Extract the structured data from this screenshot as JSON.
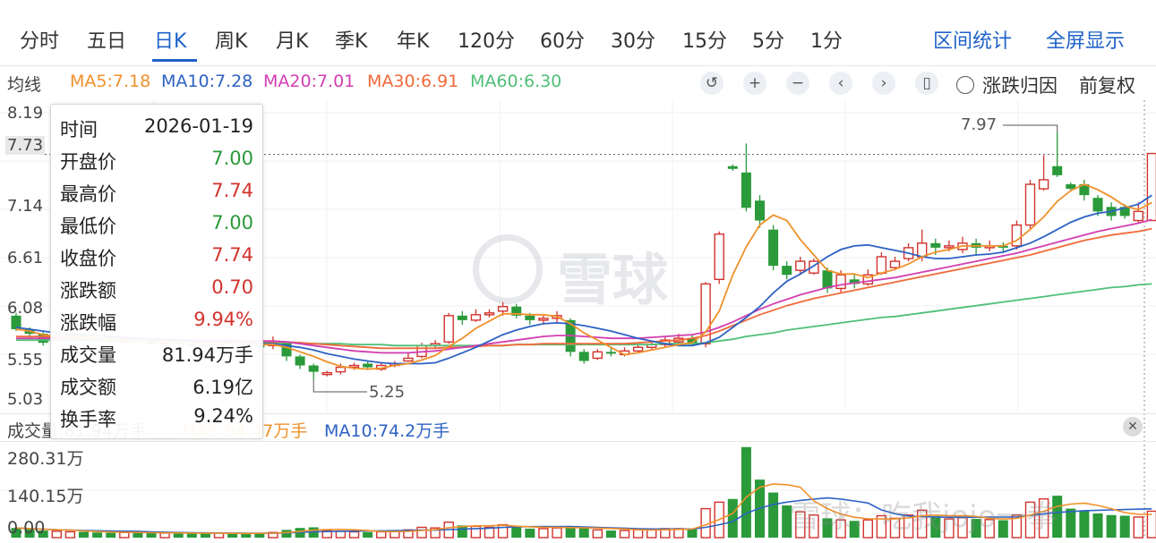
{
  "tabs": [
    {
      "label": "分时"
    },
    {
      "label": "五日"
    },
    {
      "label": "日K"
    },
    {
      "label": "周K"
    },
    {
      "label": "月K"
    },
    {
      "label": "季K"
    },
    {
      "label": "年K"
    },
    {
      "label": "120分"
    },
    {
      "label": "60分"
    },
    {
      "label": "30分"
    },
    {
      "label": "15分"
    },
    {
      "label": "5分"
    },
    {
      "label": "1分"
    }
  ],
  "active_tab": "日K",
  "right_links": {
    "interval_stats": "区间统计",
    "fullscreen": "全屏显示"
  },
  "ma_bar": {
    "label": "均线",
    "items": [
      {
        "text": "MA5:7.18",
        "color": "#f0912a"
      },
      {
        "text": "MA10:7.28",
        "color": "#2d62c4"
      },
      {
        "text": "MA20:7.01",
        "color": "#d23fb1"
      },
      {
        "text": "MA30:6.91",
        "color": "#f06a3a"
      },
      {
        "text": "MA60:6.30",
        "color": "#4fbf77"
      }
    ]
  },
  "toolbar_icons": [
    "undo-icon",
    "plus-icon",
    "minus-icon",
    "chevron-left-icon",
    "chevron-right-icon",
    "candle-icon"
  ],
  "reason_label": "涨跌归因",
  "adjust_label": "前复权",
  "y_axis": [
    "8.19",
    "7.73",
    "7.14",
    "6.61",
    "6.08",
    "5.55",
    "5.03"
  ],
  "annotations": {
    "high": "7.97",
    "low": "5.25"
  },
  "watermark": "雪球",
  "tooltip": [
    {
      "k": "时间",
      "v": "2026-01-19",
      "c": "#222"
    },
    {
      "k": "开盘价",
      "v": "7.00",
      "c": "#2a9a3a"
    },
    {
      "k": "最高价",
      "v": "7.74",
      "c": "#d2322d"
    },
    {
      "k": "最低价",
      "v": "7.00",
      "c": "#2a9a3a"
    },
    {
      "k": "收盘价",
      "v": "7.74",
      "c": "#d2322d"
    },
    {
      "k": "涨跌额",
      "v": "0.70",
      "c": "#d2322d"
    },
    {
      "k": "涨跌幅",
      "v": "9.94%",
      "c": "#d2322d"
    },
    {
      "k": "成交量",
      "v": "81.94万手",
      "c": "#222"
    },
    {
      "k": "成交额",
      "v": "6.19亿",
      "c": "#222"
    },
    {
      "k": "换手率",
      "v": "9.24%",
      "c": "#222"
    }
  ],
  "volume_header": {
    "vol": "成交量:81.94万手",
    "ma5": "MA5:64.47万手",
    "ma10": "MA10:74.2万手"
  },
  "volume_axis": [
    "280.31万",
    "140.15万",
    "0.00"
  ],
  "bottom_watermark": "雪球：吃我jojo一拳",
  "chart_data": {
    "type": "candlestick",
    "price_range": [
      5.03,
      8.19
    ],
    "volume_max": 280.31,
    "candles": [
      [
        5.95,
        5.8,
        5.98,
        5.78
      ],
      [
        5.8,
        5.75,
        5.82,
        5.7
      ],
      [
        5.75,
        5.65,
        5.78,
        5.62
      ],
      [
        5.7,
        5.72,
        5.76,
        5.66
      ],
      [
        5.72,
        5.74,
        5.78,
        5.7
      ],
      [
        5.74,
        5.7,
        5.76,
        5.68
      ],
      [
        5.7,
        5.68,
        5.73,
        5.66
      ],
      [
        5.68,
        5.66,
        5.7,
        5.64
      ],
      [
        5.66,
        5.68,
        5.72,
        5.63
      ],
      [
        5.68,
        5.66,
        5.7,
        5.64
      ],
      [
        5.66,
        5.65,
        5.68,
        5.62
      ],
      [
        5.65,
        5.66,
        5.69,
        5.63
      ],
      [
        5.66,
        5.64,
        5.68,
        5.62
      ],
      [
        5.64,
        5.63,
        5.66,
        5.6
      ],
      [
        5.63,
        5.62,
        5.66,
        5.6
      ],
      [
        5.62,
        5.66,
        5.7,
        5.6
      ],
      [
        5.66,
        5.64,
        5.68,
        5.62
      ],
      [
        5.64,
        5.62,
        5.66,
        5.6
      ],
      [
        5.62,
        5.6,
        5.64,
        5.56
      ],
      [
        5.62,
        5.64,
        5.72,
        5.58
      ],
      [
        5.65,
        5.5,
        5.66,
        5.45
      ],
      [
        5.5,
        5.4,
        5.52,
        5.36
      ],
      [
        5.4,
        5.33,
        5.42,
        5.25
      ],
      [
        5.3,
        5.32,
        5.34,
        5.28
      ],
      [
        5.33,
        5.38,
        5.42,
        5.3
      ],
      [
        5.38,
        5.4,
        5.43,
        5.35
      ],
      [
        5.42,
        5.38,
        5.44,
        5.35
      ],
      [
        5.36,
        5.4,
        5.43,
        5.34
      ],
      [
        5.4,
        5.42,
        5.45,
        5.38
      ],
      [
        5.45,
        5.48,
        5.55,
        5.44
      ],
      [
        5.5,
        5.62,
        5.65,
        5.48
      ],
      [
        5.62,
        5.64,
        5.68,
        5.58
      ],
      [
        5.66,
        5.95,
        5.98,
        5.64
      ],
      [
        5.95,
        5.9,
        6.0,
        5.85
      ],
      [
        5.9,
        5.96,
        6.02,
        5.88
      ],
      [
        5.96,
        5.98,
        6.02,
        5.93
      ],
      [
        6.0,
        6.05,
        6.1,
        5.95
      ],
      [
        6.05,
        5.95,
        6.08,
        5.92
      ],
      [
        5.95,
        5.9,
        5.98,
        5.85
      ],
      [
        5.9,
        5.92,
        5.95,
        5.86
      ],
      [
        5.92,
        5.95,
        6.0,
        5.88
      ],
      [
        5.9,
        5.55,
        5.92,
        5.5
      ],
      [
        5.55,
        5.45,
        5.58,
        5.42
      ],
      [
        5.48,
        5.55,
        5.58,
        5.46
      ],
      [
        5.55,
        5.53,
        5.6,
        5.5
      ],
      [
        5.52,
        5.56,
        5.6,
        5.5
      ],
      [
        5.56,
        5.6,
        5.64,
        5.54
      ],
      [
        5.6,
        5.63,
        5.66,
        5.58
      ],
      [
        5.63,
        5.68,
        5.72,
        5.6
      ],
      [
        5.66,
        5.7,
        5.75,
        5.64
      ],
      [
        5.7,
        5.65,
        5.74,
        5.62
      ],
      [
        5.64,
        6.3,
        6.32,
        5.6
      ],
      [
        6.35,
        6.85,
        6.88,
        6.3
      ],
      [
        7.6,
        7.57,
        7.62,
        7.55
      ],
      [
        7.53,
        7.14,
        7.85,
        7.1
      ],
      [
        7.22,
        7.0,
        7.28,
        6.92
      ],
      [
        6.9,
        6.5,
        6.95,
        6.45
      ],
      [
        6.5,
        6.4,
        6.55,
        6.35
      ],
      [
        6.45,
        6.55,
        6.6,
        6.4
      ],
      [
        6.42,
        6.55,
        6.58,
        6.4
      ],
      [
        6.45,
        6.25,
        6.48,
        6.2
      ],
      [
        6.25,
        6.4,
        6.45,
        6.2
      ],
      [
        6.35,
        6.3,
        6.42,
        6.25
      ],
      [
        6.3,
        6.4,
        6.46,
        6.28
      ],
      [
        6.42,
        6.6,
        6.65,
        6.4
      ],
      [
        6.48,
        6.55,
        6.6,
        6.45
      ],
      [
        6.58,
        6.7,
        6.75,
        6.55
      ],
      [
        6.6,
        6.75,
        6.9,
        6.55
      ],
      [
        6.75,
        6.7,
        6.8,
        6.62
      ],
      [
        6.7,
        6.72,
        6.78,
        6.66
      ],
      [
        6.68,
        6.75,
        6.82,
        6.64
      ],
      [
        6.75,
        6.7,
        6.8,
        6.62
      ],
      [
        6.7,
        6.72,
        6.78,
        6.66
      ],
      [
        6.72,
        6.7,
        6.76,
        6.65
      ],
      [
        6.72,
        6.95,
        7.0,
        6.68
      ],
      [
        6.95,
        7.4,
        7.45,
        6.9
      ],
      [
        7.35,
        7.45,
        7.72,
        7.33
      ],
      [
        7.6,
        7.5,
        7.97,
        7.48
      ],
      [
        7.4,
        7.35,
        7.42,
        7.32
      ],
      [
        7.4,
        7.28,
        7.45,
        7.22
      ],
      [
        7.25,
        7.1,
        7.28,
        7.05
      ],
      [
        7.15,
        7.05,
        7.2,
        7.0
      ],
      [
        7.15,
        7.05,
        7.18,
        7.02
      ],
      [
        7.0,
        7.1,
        7.2,
        6.98
      ],
      [
        7.0,
        7.74,
        7.74,
        7.0
      ]
    ],
    "ma5": [
      5.8,
      5.78,
      5.74,
      5.72,
      5.71,
      5.7,
      5.7,
      5.69,
      5.68,
      5.68,
      5.67,
      5.66,
      5.66,
      5.65,
      5.65,
      5.65,
      5.64,
      5.64,
      5.63,
      5.63,
      5.6,
      5.55,
      5.5,
      5.44,
      5.39,
      5.37,
      5.36,
      5.37,
      5.4,
      5.42,
      5.46,
      5.51,
      5.61,
      5.7,
      5.81,
      5.89,
      5.97,
      5.97,
      5.96,
      5.96,
      5.94,
      5.86,
      5.76,
      5.68,
      5.6,
      5.52,
      5.54,
      5.57,
      5.6,
      5.63,
      5.65,
      5.77,
      6.0,
      6.4,
      6.71,
      6.95,
      7.06,
      7.0,
      6.79,
      6.62,
      6.45,
      6.41,
      6.41,
      6.37,
      6.42,
      6.46,
      6.52,
      6.6,
      6.65,
      6.68,
      6.72,
      6.72,
      6.72,
      6.72,
      6.78,
      6.9,
      7.04,
      7.21,
      7.33,
      7.4,
      7.34,
      7.26,
      7.16,
      7.12,
      7.2
    ],
    "ma10": [
      5.82,
      5.8,
      5.78,
      5.76,
      5.75,
      5.74,
      5.73,
      5.72,
      5.71,
      5.7,
      5.69,
      5.68,
      5.68,
      5.67,
      5.66,
      5.66,
      5.65,
      5.65,
      5.64,
      5.64,
      5.62,
      5.6,
      5.57,
      5.53,
      5.5,
      5.47,
      5.45,
      5.43,
      5.42,
      5.42,
      5.42,
      5.43,
      5.48,
      5.54,
      5.6,
      5.67,
      5.74,
      5.79,
      5.83,
      5.86,
      5.87,
      5.86,
      5.84,
      5.81,
      5.78,
      5.74,
      5.7,
      5.67,
      5.64,
      5.62,
      5.62,
      5.65,
      5.71,
      5.82,
      5.93,
      6.05,
      6.2,
      6.33,
      6.41,
      6.5,
      6.6,
      6.68,
      6.72,
      6.73,
      6.7,
      6.67,
      6.64,
      6.6,
      6.58,
      6.58,
      6.6,
      6.62,
      6.63,
      6.65,
      6.7,
      6.75,
      6.82,
      6.9,
      6.98,
      7.04,
      7.08,
      7.1,
      7.14,
      7.18,
      7.28
    ],
    "ma20": [
      5.7,
      5.7,
      5.7,
      5.7,
      5.7,
      5.7,
      5.69,
      5.69,
      5.69,
      5.69,
      5.69,
      5.69,
      5.68,
      5.68,
      5.68,
      5.68,
      5.68,
      5.67,
      5.67,
      5.67,
      5.66,
      5.64,
      5.62,
      5.6,
      5.58,
      5.56,
      5.55,
      5.54,
      5.54,
      5.54,
      5.55,
      5.56,
      5.58,
      5.6,
      5.62,
      5.64,
      5.66,
      5.68,
      5.7,
      5.72,
      5.73,
      5.73,
      5.72,
      5.71,
      5.7,
      5.7,
      5.7,
      5.71,
      5.72,
      5.73,
      5.74,
      5.77,
      5.82,
      5.88,
      5.95,
      6.02,
      6.08,
      6.13,
      6.18,
      6.22,
      6.26,
      6.29,
      6.31,
      6.33,
      6.35,
      6.37,
      6.4,
      6.43,
      6.46,
      6.49,
      6.52,
      6.55,
      6.58,
      6.61,
      6.64,
      6.68,
      6.72,
      6.76,
      6.8,
      6.84,
      6.88,
      6.91,
      6.94,
      6.97,
      7.01
    ],
    "ma30": [
      5.72,
      5.72,
      5.72,
      5.71,
      5.71,
      5.71,
      5.7,
      5.7,
      5.7,
      5.7,
      5.69,
      5.69,
      5.69,
      5.68,
      5.68,
      5.68,
      5.67,
      5.67,
      5.67,
      5.66,
      5.66,
      5.65,
      5.64,
      5.63,
      5.62,
      5.61,
      5.6,
      5.59,
      5.59,
      5.59,
      5.59,
      5.59,
      5.6,
      5.6,
      5.61,
      5.62,
      5.62,
      5.63,
      5.63,
      5.64,
      5.64,
      5.64,
      5.64,
      5.64,
      5.64,
      5.64,
      5.65,
      5.66,
      5.67,
      5.68,
      5.7,
      5.73,
      5.78,
      5.84,
      5.9,
      5.96,
      6.01,
      6.06,
      6.1,
      6.14,
      6.17,
      6.2,
      6.23,
      6.26,
      6.29,
      6.32,
      6.35,
      6.38,
      6.41,
      6.44,
      6.47,
      6.5,
      6.53,
      6.56,
      6.59,
      6.62,
      6.66,
      6.7,
      6.74,
      6.78,
      6.81,
      6.84,
      6.86,
      6.88,
      6.91
    ],
    "ma60": [
      5.68,
      5.68,
      5.68,
      5.68,
      5.68,
      5.68,
      5.68,
      5.67,
      5.67,
      5.67,
      5.67,
      5.67,
      5.67,
      5.66,
      5.66,
      5.66,
      5.66,
      5.66,
      5.65,
      5.65,
      5.65,
      5.65,
      5.64,
      5.64,
      5.64,
      5.63,
      5.63,
      5.63,
      5.62,
      5.62,
      5.62,
      5.62,
      5.62,
      5.62,
      5.62,
      5.62,
      5.62,
      5.63,
      5.63,
      5.63,
      5.63,
      5.63,
      5.63,
      5.63,
      5.63,
      5.63,
      5.63,
      5.63,
      5.64,
      5.64,
      5.64,
      5.65,
      5.67,
      5.69,
      5.72,
      5.74,
      5.76,
      5.79,
      5.81,
      5.83,
      5.85,
      5.87,
      5.89,
      5.91,
      5.93,
      5.94,
      5.96,
      5.98,
      6.0,
      6.02,
      6.04,
      6.06,
      6.08,
      6.1,
      6.12,
      6.14,
      6.16,
      6.18,
      6.2,
      6.22,
      6.24,
      6.26,
      6.27,
      6.29,
      6.3
    ],
    "volumes": [
      30,
      26,
      22,
      20,
      18,
      18,
      16,
      15,
      16,
      15,
      14,
      14,
      14,
      13,
      13,
      14,
      13,
      12,
      14,
      16,
      24,
      30,
      32,
      22,
      20,
      18,
      17,
      18,
      20,
      24,
      32,
      30,
      48,
      38,
      35,
      32,
      40,
      33,
      28,
      28,
      30,
      36,
      30,
      24,
      22,
      22,
      24,
      26,
      28,
      28,
      26,
      90,
      110,
      120,
      281,
      180,
      140,
      100,
      80,
      70,
      60,
      55,
      52,
      55,
      68,
      60,
      70,
      85,
      66,
      58,
      62,
      58,
      56,
      54,
      70,
      110,
      120,
      130,
      90,
      85,
      75,
      70,
      68,
      64,
      82
    ]
  }
}
